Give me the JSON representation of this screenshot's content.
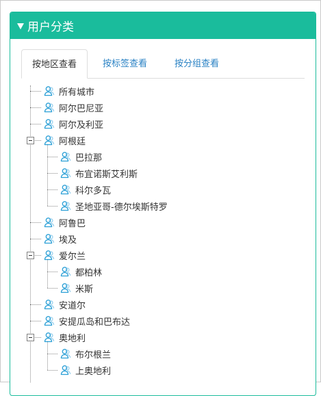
{
  "panel": {
    "title": "用户分类",
    "header_color": "#1abc9c",
    "tabs": [
      {
        "label": "按地区查看",
        "active": true
      },
      {
        "label": "按标签查看",
        "active": false
      },
      {
        "label": "按分组查看",
        "active": false
      }
    ]
  },
  "icons": {
    "node": "user-icon",
    "collapse": "minus-box-icon"
  },
  "tree": {
    "nodes": [
      {
        "label": "所有城市",
        "level": 0
      },
      {
        "label": "阿尔巴尼亚",
        "level": 0
      },
      {
        "label": "阿尔及利亚",
        "level": 0
      },
      {
        "label": "阿根廷",
        "level": 0,
        "expanded": true
      },
      {
        "label": "巴拉那",
        "level": 1
      },
      {
        "label": "布宜诺斯艾利斯",
        "level": 1
      },
      {
        "label": "科尔多瓦",
        "level": 1
      },
      {
        "label": "圣地亚哥-德尔埃斯特罗",
        "level": 1
      },
      {
        "label": "阿鲁巴",
        "level": 0
      },
      {
        "label": "埃及",
        "level": 0
      },
      {
        "label": "爱尔兰",
        "level": 0,
        "expanded": true
      },
      {
        "label": "都柏林",
        "level": 1
      },
      {
        "label": "米斯",
        "level": 1
      },
      {
        "label": "安道尔",
        "level": 0
      },
      {
        "label": "安提瓜岛和巴布达",
        "level": 0
      },
      {
        "label": "奥地利",
        "level": 0,
        "expanded": true
      },
      {
        "label": "布尔根兰",
        "level": 1
      },
      {
        "label": "上奥地利",
        "level": 1
      }
    ]
  }
}
